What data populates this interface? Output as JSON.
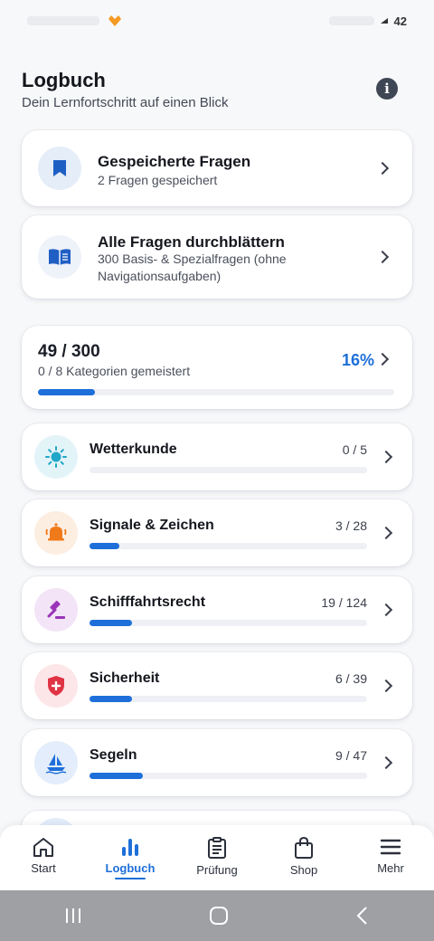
{
  "status": {
    "battery": "42"
  },
  "header": {
    "title": "Logbuch",
    "subtitle": "Dein Lernfortschritt auf einen Blick"
  },
  "saved": {
    "title": "Gespeicherte Fragen",
    "subtitle": "2 Fragen gespeichert"
  },
  "browse": {
    "title": "Alle Fragen durchblättern",
    "subtitle": "300 Basis- & Spezialfragen (ohne Navigationsaufgaben)"
  },
  "overall": {
    "count": "49 / 300",
    "categories": "0 / 8 Kategorien gemeistert",
    "percent": "16%",
    "progress": 0.16
  },
  "categories": [
    {
      "name": "Wetterkunde",
      "count": "0 / 5",
      "progress": 0.0,
      "icon": "sun-icon",
      "color": "#20a6c8",
      "bg": "#e3f4f8"
    },
    {
      "name": "Signale & Zeichen",
      "count": "3 / 28",
      "progress": 0.107,
      "icon": "bell-icon",
      "color": "#f07a1a",
      "bg": "#fdeee2"
    },
    {
      "name": "Schifffahrtsrecht",
      "count": "19 / 124",
      "progress": 0.153,
      "icon": "gavel-icon",
      "color": "#9a35b8",
      "bg": "#f3e4f7"
    },
    {
      "name": "Sicherheit",
      "count": "6 / 39",
      "progress": 0.154,
      "icon": "shield-icon",
      "color": "#e03344",
      "bg": "#fce6e8"
    },
    {
      "name": "Segeln",
      "count": "9 / 47",
      "progress": 0.191,
      "icon": "sailboat-icon",
      "color": "#1e6fd9",
      "bg": "#e3edfb"
    }
  ],
  "nav": [
    {
      "label": "Start",
      "icon": "home-icon"
    },
    {
      "label": "Logbuch",
      "icon": "chart-icon",
      "active": true
    },
    {
      "label": "Prüfung",
      "icon": "clipboard-icon"
    },
    {
      "label": "Shop",
      "icon": "bag-icon"
    },
    {
      "label": "Mehr",
      "icon": "menu-icon"
    }
  ]
}
